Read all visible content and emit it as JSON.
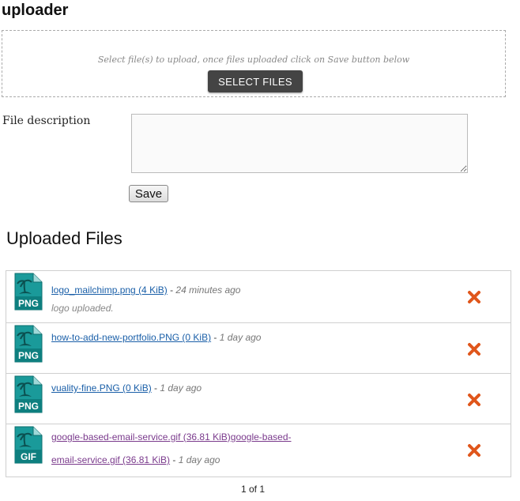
{
  "page": {
    "title": "uploader"
  },
  "uploader": {
    "hint": "Select file(s) to upload, once files uploaded click on Save button below",
    "select_label": "SELECT FILES"
  },
  "form": {
    "description_label": "File description",
    "description_value": "",
    "save_label": "Save"
  },
  "files": {
    "heading": "Uploaded Files",
    "items": [
      {
        "type_label": "PNG",
        "link": "logo_mailchimp.png (4 KiB)",
        "separator": " - ",
        "time": "24 minutes ago",
        "description": "logo uploaded."
      },
      {
        "type_label": "PNG",
        "link": "how-to-add-new-portfolio.PNG (0 KiB)",
        "separator": " - ",
        "time": "1 day ago",
        "description": ""
      },
      {
        "type_label": "PNG",
        "link": "vuality-fine.PNG (0 KiB)",
        "separator": " - ",
        "time": "1 day ago",
        "description": ""
      },
      {
        "type_label": "GIF",
        "link": "google-based-email-service.gif (36.81 KiB)google-based-email-service.gif (36.81 KiB)",
        "separator": " - ",
        "time": "1 day ago",
        "description": ""
      }
    ],
    "delete_icon": "delete-x-icon",
    "file_icon": "image-file-icon"
  },
  "pagination": {
    "text": "1 of 1"
  },
  "colors": {
    "icon_teal": "#1a9a9a",
    "delete_orange": "#e0561b",
    "link": "#1a5fa8",
    "visited_link": "#7a3a8c",
    "button_dark": "#444444"
  }
}
